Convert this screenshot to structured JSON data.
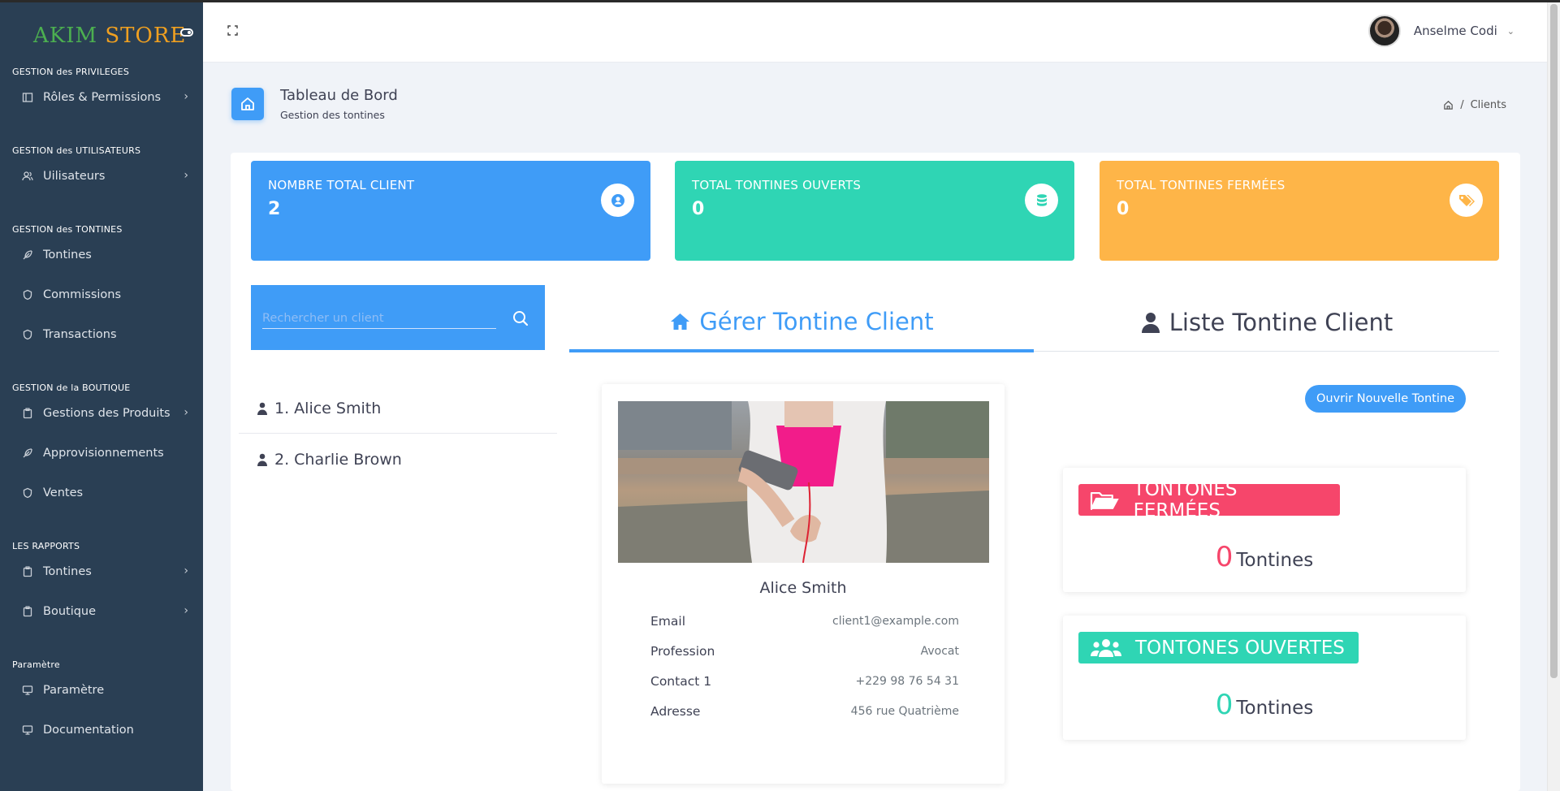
{
  "brand": {
    "part1": "AKIM",
    "part2": "STORE"
  },
  "sidebar": {
    "sections": [
      {
        "title": "GESTION des PRIVILEGES",
        "items": [
          {
            "label": "Rôles & Permissions",
            "icon": "sidebar-panel-icon",
            "has_submenu": true
          }
        ]
      },
      {
        "title": "GESTION des UTILISATEURS",
        "items": [
          {
            "label": "Uilisateurs",
            "icon": "users-icon",
            "has_submenu": true
          }
        ]
      },
      {
        "title": "GESTION des TONTINES",
        "items": [
          {
            "label": "Tontines",
            "icon": "feather-icon",
            "has_submenu": false
          },
          {
            "label": "Commissions",
            "icon": "shield-icon",
            "has_submenu": false
          },
          {
            "label": "Transactions",
            "icon": "shield-icon",
            "has_submenu": false
          }
        ]
      },
      {
        "title": "GESTION de la BOUTIQUE",
        "items": [
          {
            "label": "Gestions des Produits",
            "icon": "clipboard-icon",
            "has_submenu": true
          },
          {
            "label": "Approvisionnements",
            "icon": "feather-icon",
            "has_submenu": false
          },
          {
            "label": "Ventes",
            "icon": "shield-icon",
            "has_submenu": false
          }
        ]
      },
      {
        "title": "LES RAPPORTS",
        "items": [
          {
            "label": "Tontines",
            "icon": "clipboard-icon",
            "has_submenu": true
          },
          {
            "label": "Boutique",
            "icon": "clipboard-icon",
            "has_submenu": true
          }
        ]
      },
      {
        "title": "Paramètre",
        "items": [
          {
            "label": "Paramètre",
            "icon": "monitor-icon",
            "has_submenu": false
          },
          {
            "label": "Documentation",
            "icon": "monitor-icon",
            "has_submenu": false
          }
        ]
      }
    ]
  },
  "header": {
    "user_name": "Anselme Codi"
  },
  "page": {
    "title": "Tableau de Bord",
    "subtitle": "Gestion des tontines",
    "breadcrumb": [
      "Clients"
    ]
  },
  "stats": [
    {
      "label": "NOMBRE TOTAL CLIENT",
      "value": "2",
      "icon": "user-icon",
      "color": "#3f9cf7"
    },
    {
      "label": "TOTAL TONTINES OUVERTS",
      "value": "0",
      "icon": "database-icon",
      "color": "#2fd5b4"
    },
    {
      "label": "TOTAL TONTINES FERMÉES",
      "value": "0",
      "icon": "tag-icon",
      "color": "#feb548"
    }
  ],
  "search": {
    "placeholder": "Rechercher un client"
  },
  "clients": [
    "1. Alice Smith",
    "2. Charlie Brown"
  ],
  "tabs": [
    {
      "label": "Gérer Tontine Client",
      "active": true
    },
    {
      "label": "Liste Tontine Client",
      "active": false
    }
  ],
  "profile": {
    "name": "Alice Smith",
    "fields": [
      {
        "key": "Email",
        "value": "client1@example.com"
      },
      {
        "key": "Profession",
        "value": "Avocat"
      },
      {
        "key": "Contact 1",
        "value": "+229 98 76 54 31"
      },
      {
        "key": "Adresse",
        "value": "456 rue Quatrième"
      }
    ]
  },
  "open_button": "Ouvrir Nouvelle Tontine",
  "tontine_cards": [
    {
      "title": "TONTONES FERMÉES",
      "count": "0",
      "unit": "Tontines",
      "color": "#f6466b"
    },
    {
      "title": "TONTONES OUVERTES",
      "count": "0",
      "unit": "Tontines",
      "color": "#2fd5b4"
    }
  ]
}
